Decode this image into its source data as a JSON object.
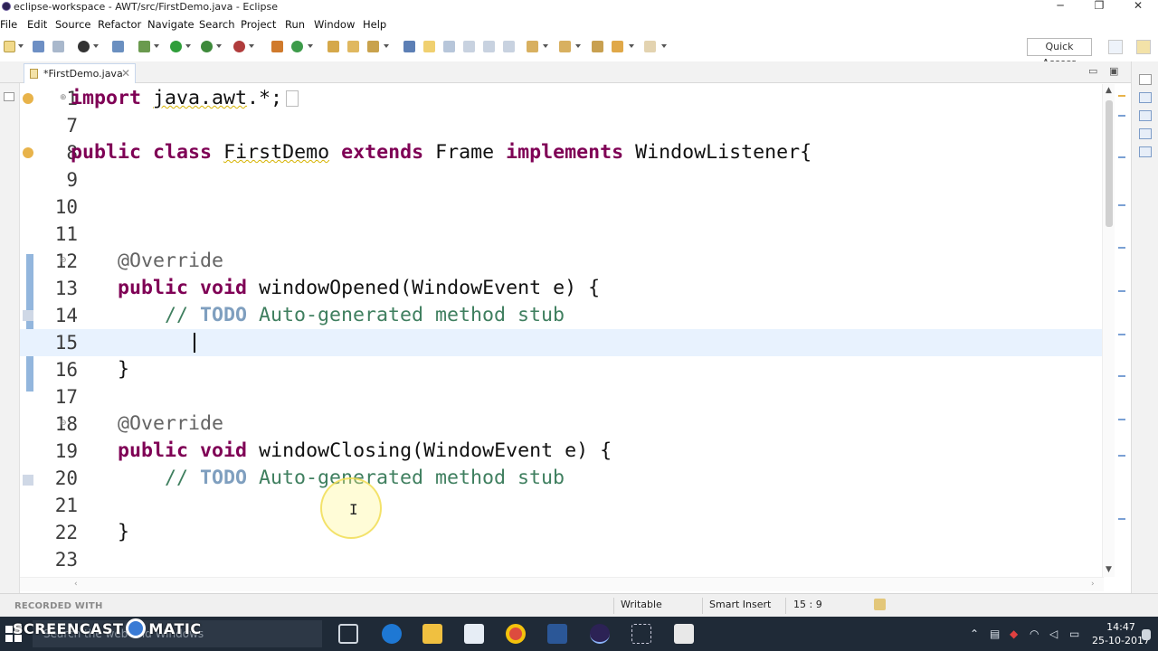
{
  "window": {
    "title": "eclipse-workspace - AWT/src/FirstDemo.java - Eclipse",
    "minimize": "─",
    "restore": "❐",
    "close": "✕"
  },
  "menu": [
    "File",
    "Edit",
    "Source",
    "Refactor",
    "Navigate",
    "Search",
    "Project",
    "Run",
    "Window",
    "Help"
  ],
  "toolbar": {
    "quick_access": "Quick Access"
  },
  "editor_tab": {
    "name": "*FirstDemo.java",
    "close": "✕"
  },
  "code_lines": [
    {
      "num": "1",
      "text": "import java.awt.*;"
    },
    {
      "num": "7",
      "text": ""
    },
    {
      "num": "8",
      "text": "public class FirstDemo extends Frame implements WindowListener{"
    },
    {
      "num": "9",
      "text": ""
    },
    {
      "num": "10",
      "text": ""
    },
    {
      "num": "11",
      "text": ""
    },
    {
      "num": "12",
      "text": "    @Override"
    },
    {
      "num": "13",
      "text": "    public void windowOpened(WindowEvent e) {"
    },
    {
      "num": "14",
      "text": "        // TODO Auto-generated method stub"
    },
    {
      "num": "15",
      "text": ""
    },
    {
      "num": "16",
      "text": "    }"
    },
    {
      "num": "17",
      "text": ""
    },
    {
      "num": "18",
      "text": "    @Override"
    },
    {
      "num": "19",
      "text": "    public void windowClosing(WindowEvent e) {"
    },
    {
      "num": "20",
      "text": "        // TODO Auto-generated method stub"
    },
    {
      "num": "21",
      "text": ""
    },
    {
      "num": "22",
      "text": "    }"
    },
    {
      "num": "23",
      "text": ""
    }
  ],
  "status": {
    "writable": "Writable",
    "insert_mode": "Smart Insert",
    "position": "15 : 9"
  },
  "watermark": {
    "recorded": "RECORDED WITH",
    "brand_left": "SCREENCAST",
    "brand_right": "MATIC"
  },
  "taskbar": {
    "search_placeholder": "Search the web and Windows",
    "time": "14:47",
    "date": "25-10-2017"
  },
  "colors": {
    "keyword": "#7f0055",
    "comment": "#3f7f5f",
    "annotation": "#646464",
    "current_line": "#e8f2fe",
    "taskbar": "#1f2a37"
  }
}
